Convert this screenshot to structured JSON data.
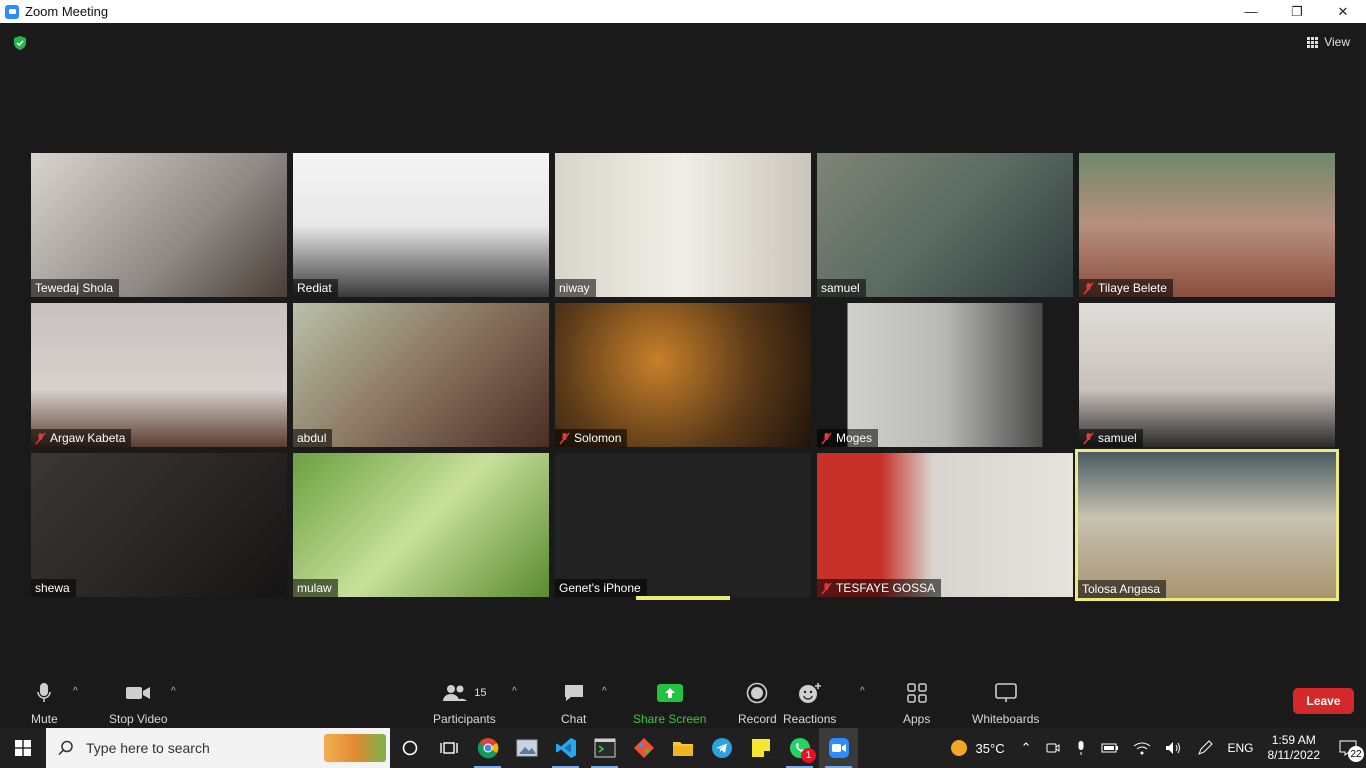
{
  "window": {
    "title": "Zoom Meeting",
    "minimize": "—",
    "maximize": "❐",
    "close": "✕"
  },
  "header": {
    "view_label": "View"
  },
  "participants": [
    {
      "name": "Tewedaj Shola",
      "muted": false
    },
    {
      "name": "Rediat",
      "muted": false
    },
    {
      "name": "niway",
      "muted": false
    },
    {
      "name": "samuel",
      "muted": false
    },
    {
      "name": "Tilaye Belete",
      "muted": true
    },
    {
      "name": "Argaw Kabeta",
      "muted": true
    },
    {
      "name": "abdul",
      "muted": false
    },
    {
      "name": "Solomon",
      "muted": true
    },
    {
      "name": "Moges",
      "muted": true
    },
    {
      "name": "samuel",
      "muted": true
    },
    {
      "name": "shewa",
      "muted": false
    },
    {
      "name": "mulaw",
      "muted": false
    },
    {
      "name": "Genet's iPhone",
      "muted": false
    },
    {
      "name": "TESFAYE GOSSA",
      "muted": true
    },
    {
      "name": "Tolosa Angasa",
      "muted": false
    }
  ],
  "toolbar": {
    "mute": "Mute",
    "stop_video": "Stop Video",
    "participants": "Participants",
    "participants_count": "15",
    "chat": "Chat",
    "share_screen": "Share Screen",
    "record": "Record",
    "reactions": "Reactions",
    "apps": "Apps",
    "whiteboards": "Whiteboards",
    "leave": "Leave"
  },
  "taskbar": {
    "search_placeholder": "Type here to search",
    "weather": "35°C",
    "language": "ENG",
    "time": "1:59 AM",
    "date": "8/11/2022",
    "notifications": "22",
    "whatsapp_badge": "1"
  },
  "colors": {
    "accent_speaker": "#ecec78",
    "leave": "#d4292a",
    "share_green": "#3cc83c",
    "zoom_blue": "#2d8cff"
  }
}
